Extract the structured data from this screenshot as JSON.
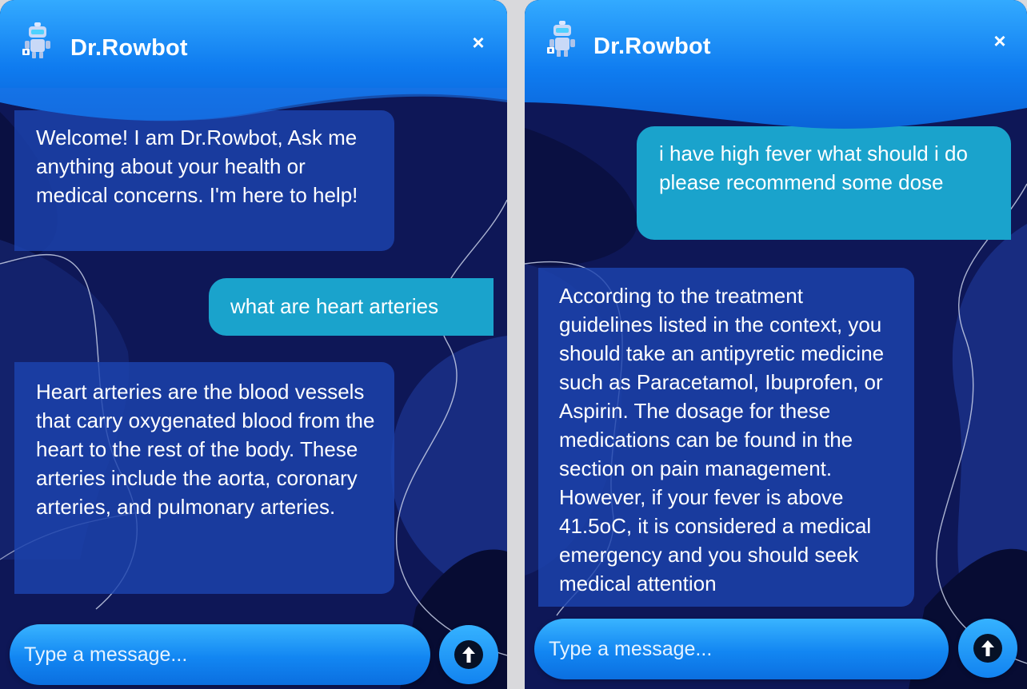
{
  "colors": {
    "panel_bg": "#0e1757",
    "header_blue": "#0f7cf0",
    "bot_bubble": "#1c43ae",
    "user_bubble": "#1aa3cc",
    "text": "#ffffff"
  },
  "left": {
    "header": {
      "title": "Dr.Rowbot",
      "icon": "robot-icon",
      "close": "×"
    },
    "messages": [
      {
        "role": "bot",
        "text": "Welcome! I am Dr.Rowbot, Ask me anything about your health or medical concerns. I'm here to help!"
      },
      {
        "role": "user",
        "text": "what are heart arteries"
      },
      {
        "role": "bot",
        "text": "Heart arteries are the blood vessels that carry oxygenated blood from the heart to the rest of the body. These arteries include the aorta, coronary arteries, and pulmonary arteries."
      }
    ],
    "input": {
      "placeholder": "Type a message...",
      "value": ""
    },
    "send_icon": "arrow-up-icon"
  },
  "right": {
    "header": {
      "title": "Dr.Rowbot",
      "icon": "robot-icon",
      "close": "×"
    },
    "messages": [
      {
        "role": "user",
        "text": "i have high fever what should i do please recommend some dose"
      },
      {
        "role": "bot",
        "text": "According to the treatment guidelines listed in the context, you should take an antipyretic medicine such as Paracetamol, Ibuprofen, or Aspirin. The dosage for these medications can be found in the section on pain management. However, if your fever is above 41.5oC, it is considered a medical emergency and you should seek medical attention"
      }
    ],
    "input": {
      "placeholder": "Type a message...",
      "value": ""
    },
    "send_icon": "arrow-up-icon"
  }
}
